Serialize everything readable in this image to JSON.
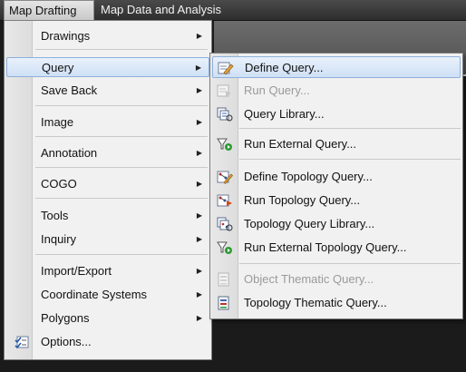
{
  "menubar": {
    "items": [
      {
        "label": "Map Drafting"
      },
      {
        "label": "Map Data and Analysis"
      }
    ]
  },
  "menu": {
    "items": [
      {
        "label": "Drawings",
        "arrow": "▶"
      },
      {
        "label": "Query",
        "arrow": "▶"
      },
      {
        "label": "Save Back",
        "arrow": "▶"
      },
      {
        "label": "Image",
        "arrow": "▶"
      },
      {
        "label": "Annotation",
        "arrow": "▶"
      },
      {
        "label": "COGO",
        "arrow": "▶"
      },
      {
        "label": "Tools",
        "arrow": "▶"
      },
      {
        "label": "Inquiry",
        "arrow": "▶"
      },
      {
        "label": "Import/Export",
        "arrow": "▶"
      },
      {
        "label": "Coordinate Systems",
        "arrow": "▶"
      },
      {
        "label": "Polygons",
        "arrow": "▶"
      },
      {
        "label": "Options..."
      }
    ]
  },
  "submenu": {
    "items": [
      {
        "label": "Define Query...",
        "icon": "define-query-icon"
      },
      {
        "label": "Run Query...",
        "icon": "run-query-icon",
        "disabled": true
      },
      {
        "label": "Query Library...",
        "icon": "query-library-icon"
      },
      {
        "label": "Run External Query...",
        "icon": "run-external-query-icon"
      },
      {
        "label": "Define Topology Query...",
        "icon": "define-topology-query-icon"
      },
      {
        "label": "Run Topology Query...",
        "icon": "run-topology-query-icon"
      },
      {
        "label": "Topology Query Library...",
        "icon": "topology-query-library-icon"
      },
      {
        "label": "Run External Topology Query...",
        "icon": "run-external-topology-query-icon"
      },
      {
        "label": "Object Thematic Query...",
        "icon": "object-thematic-query-icon",
        "disabled": true
      },
      {
        "label": "Topology Thematic Query...",
        "icon": "topology-thematic-query-icon"
      }
    ]
  }
}
